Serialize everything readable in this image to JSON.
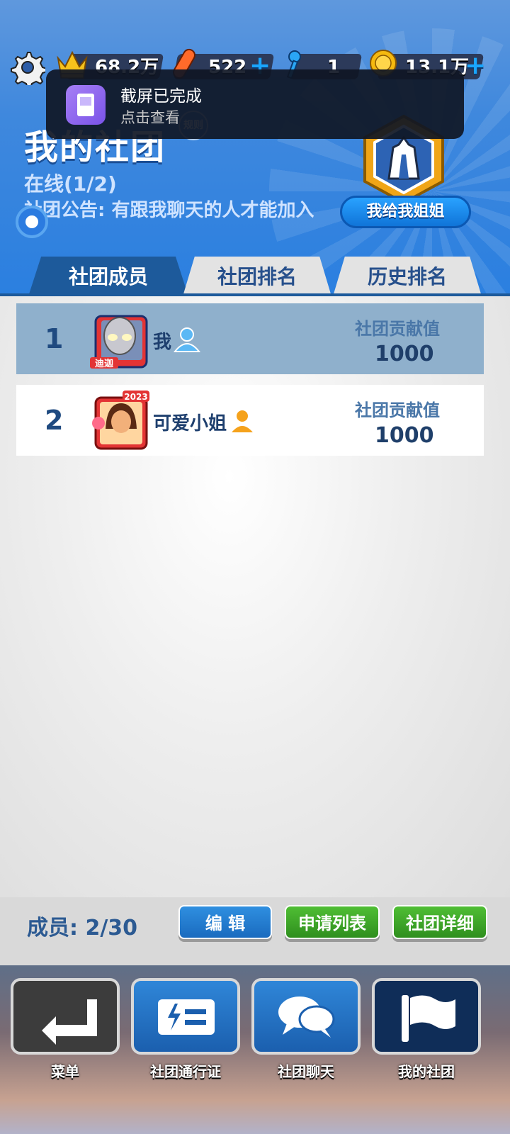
{
  "topbar": {
    "crown_value": "68.2万",
    "board_value": "522",
    "key_value": "1",
    "coin_value": "13.1万",
    "plus_label": "+"
  },
  "toast": {
    "title": "截屏已完成",
    "subtitle": "点击查看"
  },
  "club": {
    "title": "我的社团",
    "rules_label": "规则",
    "online": "在线(1/2)",
    "notice": "社团公告: 有跟我聊天的人才能加入",
    "name": "我给我姐姐"
  },
  "tabs": [
    "社团成员",
    "社团排名",
    "历史排名"
  ],
  "members": [
    {
      "rank": "1",
      "name": "我",
      "contrib_label": "社团贡献值",
      "contrib": "1000",
      "frame_text": "迪迦"
    },
    {
      "rank": "2",
      "name": "可爱小姐",
      "contrib_label": "社团贡献值",
      "contrib": "1000",
      "frame_text": "2023"
    }
  ],
  "footer": {
    "member_count": "成员: 2/30",
    "edit_label": "编 辑",
    "apply_label": "申请列表",
    "detail_label": "社团详细"
  },
  "nav": [
    {
      "label": "菜单",
      "icon": "enter-arrow-icon"
    },
    {
      "label": "社团通行证",
      "icon": "pass-ticket-icon"
    },
    {
      "label": "社团聊天",
      "icon": "chat-bubbles-icon"
    },
    {
      "label": "我的社团",
      "icon": "flag-icon"
    }
  ],
  "colors": {
    "header_blue": "#2a7fe0",
    "tab_active": "#1d5a9b",
    "btn_blue": "#1a6bbf",
    "btn_green": "#2f8f1e"
  }
}
